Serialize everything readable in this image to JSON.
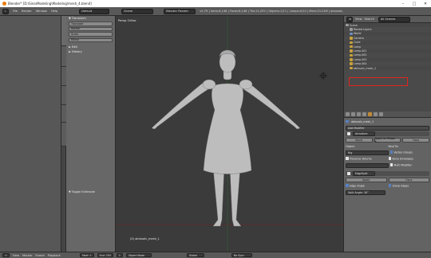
{
  "window": {
    "title": "Blender* [D:\\Sina\\Modeling\\Modeling\\mesh_4.blend]",
    "controls": [
      "–",
      "□",
      "✕"
    ]
  },
  "topbar": {
    "menus": [
      "File",
      "Render",
      "Window",
      "Help"
    ],
    "layout": "Default",
    "scene": "Scene",
    "engine": "Blender Render",
    "stats": "v2.79 | Verts:6,148 | Faces:6,146 | Tris:12,292 | Objects:1/11 | Lamps:0/10 | Mem:23.21M | ablusalv_mesh_1"
  },
  "tools_tabs": [
    "Tools",
    "Create",
    "Relations",
    "Animation",
    "Physics",
    "Grease Pencil"
  ],
  "left_panel": {
    "transform_header": "▼ Transform",
    "buttons": [
      "Translate",
      "Rotate",
      "Scale",
      "Mirror"
    ],
    "edit_header": "► Edit",
    "history_header": "► History",
    "toggle_editmode": "▼ Toggle Editmode"
  },
  "viewport": {
    "label": "Persp Ortho",
    "object_label": "(0) ablusalv_mesh_1"
  },
  "outliner": {
    "menus": [
      "View",
      "Search",
      "All Scenes"
    ],
    "rows": [
      {
        "indent": 0,
        "label": "Scene",
        "icon": "scene-icon",
        "color": "#9a9a9a"
      },
      {
        "indent": 1,
        "label": "RenderLayers",
        "icon": "render-layers-icon",
        "color": "#9a9a9a"
      },
      {
        "indent": 1,
        "label": "World",
        "icon": "world-icon",
        "color": "#6f8fbf"
      },
      {
        "indent": 1,
        "label": "Camera",
        "icon": "camera-icon",
        "color": "#c9a13c"
      },
      {
        "indent": 1,
        "label": "Cube",
        "icon": "mesh-icon",
        "color": "#c9a13c"
      },
      {
        "indent": 1,
        "label": "Lamp",
        "icon": "lamp-icon",
        "color": "#c9a13c"
      },
      {
        "indent": 1,
        "label": "Lamp.001",
        "icon": "lamp-icon",
        "color": "#c9a13c"
      },
      {
        "indent": 1,
        "label": "Lamp.002",
        "icon": "lamp-icon",
        "color": "#c9a13c"
      },
      {
        "indent": 1,
        "label": "Lamp.003",
        "icon": "lamp-icon",
        "color": "#c9a13c"
      },
      {
        "indent": 1,
        "label": "Lamp.004",
        "icon": "lamp-icon",
        "color": "#c9a13c"
      },
      {
        "indent": 1,
        "label": "ablusalv_mesh_1",
        "icon": "mesh-icon",
        "color": "#c9a13c"
      }
    ]
  },
  "properties": {
    "object_name": "ablusalv_mesh_1",
    "add_modifier": "Add Modifier",
    "mod1": {
      "name": "Armature",
      "apply": "Apply",
      "apply_shape": "Apply as Shape K...",
      "copy": "Copy",
      "object_label": "Object:",
      "object_value": "Rig",
      "bind_to_label": "Bind To:",
      "opts": [
        "Preserve Volume",
        "Multi Modifier"
      ],
      "bind_opts": [
        "Vertex Groups",
        "Bone Envelopes"
      ]
    },
    "mod2": {
      "name": "EdgeSplit",
      "apply": "Apply",
      "copy": "Copy",
      "edge_angle": "Edge Angle",
      "sharp_edges": "Sharp Edges",
      "split_angle": "Split Angle: 30°"
    }
  },
  "bottombar": {
    "menus": [
      "View",
      "Marker",
      "Frame",
      "Playback"
    ],
    "start": "Start:",
    "start_val": "1",
    "end": "End:",
    "end_val": "250",
    "frame_val": "1",
    "mode": "Object Mode",
    "pivot": "Global",
    "sync": "No Sync"
  }
}
